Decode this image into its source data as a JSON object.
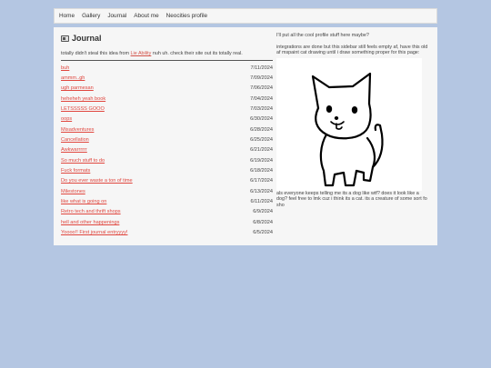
{
  "nav": {
    "items": [
      "Home",
      "Gallery",
      "Journal",
      "About me",
      "Neocities profile"
    ]
  },
  "journal": {
    "title": "Journal",
    "title_icon": "photo-icon",
    "intro_before": "totally didn't steal this idea from ",
    "intro_link": "Lie Ability",
    "intro_after": " nuh uh. check their site out its totally real.",
    "entries": [
      {
        "title": "buh",
        "date": "7/11/2024"
      },
      {
        "title": "ammm..gh",
        "date": "7/09/2024"
      },
      {
        "title": "ugh parmesan",
        "date": "7/06/2024"
      },
      {
        "title": "heheheh yeah book",
        "date": "7/04/2024"
      },
      {
        "title": "LETSSSSS GOOO",
        "date": "7/03/2024"
      },
      {
        "title": "oops",
        "date": "6/30/2024"
      },
      {
        "title": "Misadventures",
        "date": "6/28/2024"
      },
      {
        "title": "Cancellation",
        "date": "6/25/2024"
      },
      {
        "title": "Awkwarrrrrr",
        "date": "6/21/2024"
      },
      {
        "title": "So much stuff to do",
        "date": "6/19/2024"
      },
      {
        "title": "Fuck formats",
        "date": "6/18/2024"
      },
      {
        "title": "Do you ever waste a ton of time",
        "date": "6/17/2024"
      },
      {
        "title": "Milestones",
        "date": "6/13/2024"
      },
      {
        "title": "like what is going on",
        "date": "6/11/2024"
      },
      {
        "title": "Retro tech and thrift shops",
        "date": "6/9/2024"
      },
      {
        "title": "hell and other happenings",
        "date": "6/8/2024"
      },
      {
        "title": "Yoooo!! First journal entryyyy!",
        "date": "6/5/2024"
      }
    ]
  },
  "sidebar": {
    "note1": "I'll put all the cool profile stuff here maybe?",
    "note2": "integrations are done but this sidebar still feels empty af, have this old af mspaint cat drawing until i draw something proper for this page:",
    "note3": "als everyone keeps telling me its a dog like wtf? does it look like a dog? feel free to lmk cuz i think its a cat. its a creature of some sort fo sho"
  },
  "colors": {
    "background": "#b4c6e2",
    "panel": "#f6f6f6",
    "link": "#e0463e"
  }
}
